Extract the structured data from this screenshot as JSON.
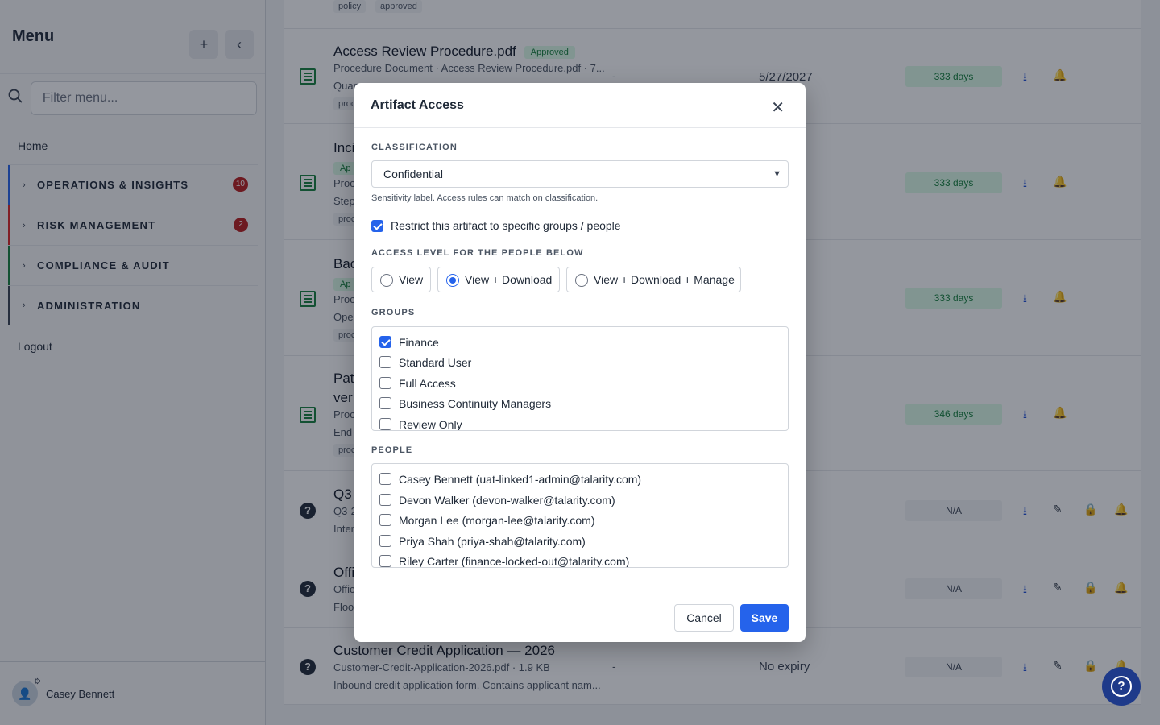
{
  "sidebar": {
    "title": "Menu",
    "add_icon": "plus-icon",
    "collapse_icon": "chevron-left-icon",
    "filter_placeholder": "Filter menu...",
    "home": "Home",
    "sections": [
      {
        "label": "OPERATIONS & INSIGHTS",
        "badge": "10",
        "color": "#2563eb"
      },
      {
        "label": "RISK MANAGEMENT",
        "badge": "2",
        "color": "#dc2626"
      },
      {
        "label": "COMPLIANCE & AUDIT",
        "badge": "",
        "color": "#15803d"
      },
      {
        "label": "ADMINISTRATION",
        "badge": "",
        "color": "#374151"
      }
    ],
    "logout": "Logout",
    "user_name": "Casey Bennett"
  },
  "rows": [
    {
      "tags": [
        "policy",
        "approved"
      ]
    },
    {
      "title": "Access Review Procedure.pdf",
      "status": "Approved",
      "meta": "Procedure Document · Access Review Procedure.pdf · 7...",
      "desc": "Quart",
      "tag": "proc",
      "dash": "-",
      "expiry": "5/27/2027",
      "days": "333 days"
    },
    {
      "title": "Inci",
      "status": "Ap",
      "meta": "Proc",
      "desc": "Step",
      "tag": "proc",
      "expiry": "27",
      "days": "333 days"
    },
    {
      "title": "Bac",
      "status": "Ap",
      "meta": "Proc",
      "desc": "Oper",
      "tag": "proc",
      "expiry": "27",
      "days": "333 days"
    },
    {
      "title": "Pat",
      "title2": "ver",
      "meta": "Proc",
      "desc": "End-",
      "tag": "proc",
      "expiry": "7",
      "days": "346 days"
    },
    {
      "title": "Q3",
      "meta": "Q3-2",
      "desc": "Inter",
      "expiry": "y",
      "days": "N/A"
    },
    {
      "title": "Offi",
      "meta": "Offic",
      "desc": "Floo",
      "expiry": "y",
      "days": "N/A"
    },
    {
      "title": "Customer Credit Application — 2026",
      "meta": "Customer-Credit-Application-2026.pdf · 1.9 KB",
      "desc": "Inbound credit application form. Contains applicant nam...",
      "dash": "-",
      "expiry": "No expiry",
      "days": "N/A"
    }
  ],
  "modal": {
    "title": "Artifact Access",
    "close_icon": "close-icon",
    "classification_label": "CLASSIFICATION",
    "classification_value": "Confidential",
    "classification_hint": "Sensitivity label. Access rules can match on classification.",
    "restrict_label": "Restrict this artifact to specific groups / people",
    "restrict_checked": true,
    "access_level_label": "ACCESS LEVEL FOR THE PEOPLE BELOW",
    "access_levels": [
      "View",
      "View + Download",
      "View + Download + Manage"
    ],
    "access_selected": "View + Download",
    "groups_label": "GROUPS",
    "groups": [
      {
        "label": "Finance",
        "checked": true
      },
      {
        "label": "Standard User",
        "checked": false
      },
      {
        "label": "Full Access",
        "checked": false
      },
      {
        "label": "Business Continuity Managers",
        "checked": false
      },
      {
        "label": "Review Only",
        "checked": false
      }
    ],
    "people_label": "PEOPLE",
    "people": [
      {
        "label": "Casey Bennett (uat-linked1-admin@talarity.com)",
        "checked": false
      },
      {
        "label": "Devon Walker (devon-walker@talarity.com)",
        "checked": false
      },
      {
        "label": "Morgan Lee (morgan-lee@talarity.com)",
        "checked": false
      },
      {
        "label": "Priya Shah (priya-shah@talarity.com)",
        "checked": false
      },
      {
        "label": "Riley Carter (finance-locked-out@talarity.com)",
        "checked": false
      }
    ],
    "cancel": "Cancel",
    "save": "Save"
  },
  "help_icon": "help-icon"
}
